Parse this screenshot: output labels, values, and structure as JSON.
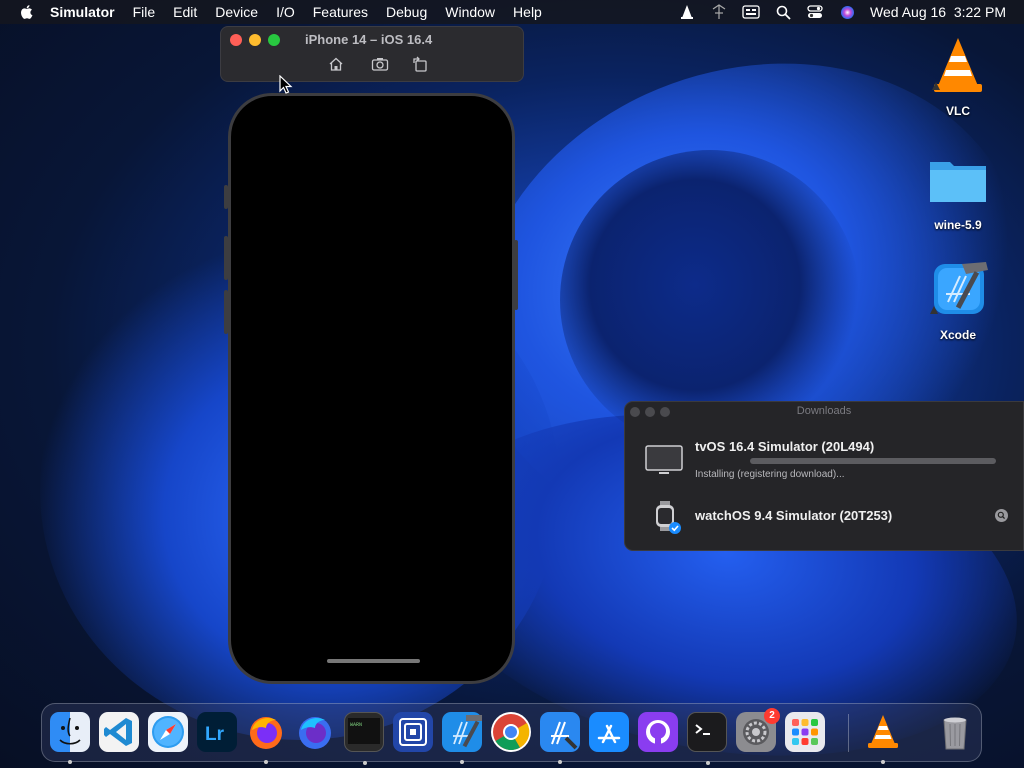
{
  "menubar": {
    "app_name": "Simulator",
    "menus": [
      "File",
      "Edit",
      "Device",
      "I/O",
      "Features",
      "Debug",
      "Window",
      "Help"
    ],
    "clock": "Wed Aug 16  3:22 PM"
  },
  "simulator": {
    "window_title": "iPhone 14 – iOS 16.4",
    "toolbar": [
      "home-icon",
      "screenshot-icon",
      "rotate-icon"
    ]
  },
  "desktop_icons": [
    {
      "label": "VLC",
      "icon": "vlc-icon"
    },
    {
      "label": "wine-5.9",
      "icon": "folder-icon"
    },
    {
      "label": "Xcode",
      "icon": "xcode-icon"
    }
  ],
  "downloads": {
    "window_title": "Downloads",
    "items": [
      {
        "title": "tvOS 16.4 Simulator (20L494)",
        "status": "Installing (registering download)...",
        "progress": 0.0
      },
      {
        "title": "watchOS 9.4 Simulator (20T253)"
      }
    ]
  },
  "dock": {
    "apps": [
      "Finder",
      "Visual Studio Code",
      "Safari",
      "Lightroom",
      "Firefox",
      "Firefox Developer Edition",
      "Console",
      "Unknown App",
      "Xcode",
      "Google Chrome",
      "Instruments",
      "App Store",
      "GitHub Desktop",
      "Terminal",
      "System Settings",
      "Launchpad",
      "VLC",
      "Trash"
    ],
    "system_settings_badge": "2"
  },
  "colors": {
    "close": "#ff5f57",
    "minimize": "#febc2e",
    "zoom": "#28c840",
    "badge": "#ff3b30"
  }
}
